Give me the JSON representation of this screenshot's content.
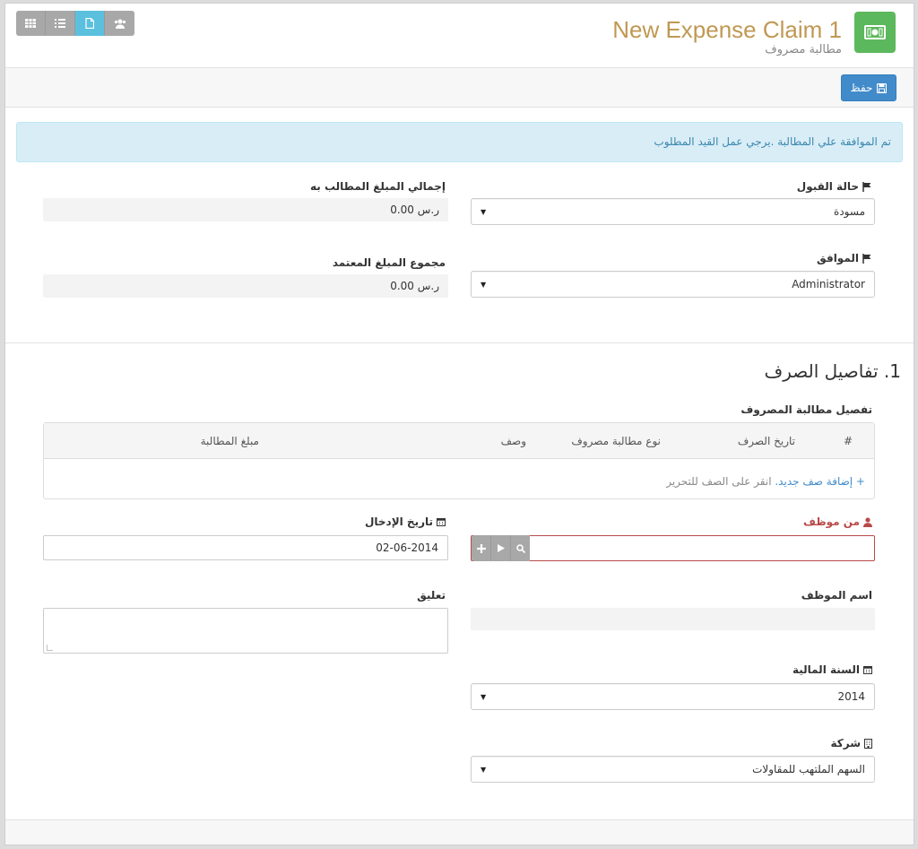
{
  "header": {
    "title": "New Expense Claim 1",
    "subtitle": "مطالبة مصروف",
    "view_buttons": [
      "grid-view",
      "list-view",
      "form-view",
      "users-view"
    ]
  },
  "toolbar": {
    "save_label": "حفظ"
  },
  "alert": {
    "text": "تم الموافقة علي المطالبة .يرجي عمل القيد المطلوب"
  },
  "fields": {
    "approval_status": {
      "label": "حالة القبول",
      "value": "مسودة"
    },
    "approver": {
      "label": "الموافق",
      "value": "Administrator"
    },
    "total_claimed": {
      "label": "إجمالي المبلغ المطالب به",
      "value": "ر.س 0.00"
    },
    "total_sanctioned": {
      "label": "مجموع المبلغ المعتمد",
      "value": "ر.س 0.00"
    },
    "employee": {
      "label": "من موظف",
      "value": ""
    },
    "posting_date": {
      "label": "تاريخ الإدخال",
      "value": "02-06-2014"
    },
    "employee_name": {
      "label": "اسم الموظف",
      "value": ""
    },
    "remark": {
      "label": "تعليق",
      "value": ""
    },
    "fiscal_year": {
      "label": "السنة المالية",
      "value": "2014"
    },
    "company": {
      "label": "شركة",
      "value": "السهم الملتهب للمقاولات"
    }
  },
  "section": {
    "title": "1. تفاصيل الصرف",
    "grid_label": "تفصيل مطالبة المصروف",
    "columns": [
      "#",
      "تاريخ الصرف",
      "نوع مطالبة مصروف",
      "وصف",
      "مبلغ المطالبة"
    ],
    "add_row": "+ إضافة صف جديد.",
    "hint": " انقر على الصف للتحرير"
  },
  "colors": {
    "title": "#c09853",
    "primary": "#428bca",
    "success": "#5cb85c",
    "info_bg": "#d9edf7",
    "error": "#b94a48"
  }
}
